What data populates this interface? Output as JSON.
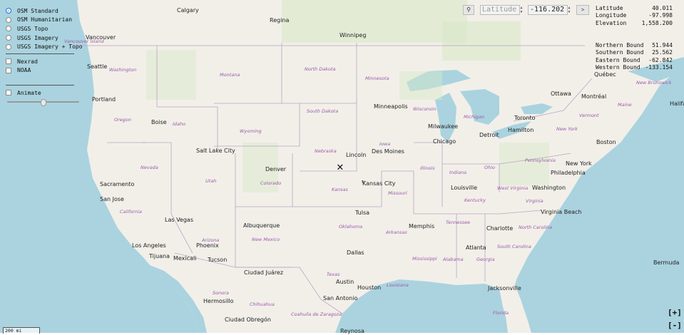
{
  "layers": {
    "base_options": [
      {
        "label": "OSM Standard",
        "selected": true
      },
      {
        "label": "OSM Humanitarian",
        "selected": false
      },
      {
        "label": "USGS Topo",
        "selected": false
      },
      {
        "label": "USGS Imagery",
        "selected": false
      },
      {
        "label": "USGS Imagery + Topo",
        "selected": false
      }
    ],
    "overlays": [
      {
        "label": "Nexrad",
        "checked": false
      },
      {
        "label": "NOAA",
        "checked": false
      }
    ],
    "animate_label": "Animate",
    "animate_checked": false,
    "animate_slider_fraction": 0.5
  },
  "toolbar": {
    "latitude_placeholder": "Latitude",
    "longitude_value": "-116.202",
    "go_label": ">"
  },
  "info": {
    "latitude_label": "Latitude",
    "latitude_value": "40.011",
    "longitude_label": "Longitude",
    "longitude_value": "-97.998",
    "elevation_label": "Elevation",
    "elevation_value": "1,558.200",
    "north_label": "Northern Bound",
    "north_value": "51.944",
    "south_label": "Southern Bound",
    "south_value": "25.562",
    "east_label": "Eastern Bound",
    "east_value": "-62.842",
    "west_label": "Western Bound",
    "west_value": "-133.154"
  },
  "zoom": {
    "in_label": "[+]",
    "out_label": "[-]"
  },
  "scale_label": "200 mi",
  "colors": {
    "land": "#f2efe9",
    "water": "#aad3df",
    "park": "#d8e8c8",
    "border": "#b7a6c2",
    "state_label": "#9a5aa8"
  },
  "map_labels": {
    "cities": [
      "Calgary",
      "Regina",
      "Winnipeg",
      "Vancouver",
      "Seattle",
      "Portland",
      "Boise",
      "Salt Lake City",
      "Sacramento",
      "San Jose",
      "Las Vegas",
      "Los Angeles",
      "Tijuana",
      "Mexicali",
      "Phoenix",
      "Tucson",
      "Albuquerque",
      "Denver",
      "Ciudad Juárez",
      "Hermosillo",
      "Ciudad Obregón",
      "Lincoln",
      "Kansas City",
      "Tulsa",
      "Dallas",
      "Austin",
      "San Antonio",
      "Houston",
      "Minneapolis",
      "Des Moines",
      "Milwaukee",
      "Chicago",
      "Detroit",
      "Toronto",
      "Hamilton",
      "Ottawa",
      "Montréal",
      "Québec",
      "Boston",
      "New York",
      "Philadelphia",
      "Washington",
      "Virginia Beach",
      "Louisville",
      "Memphis",
      "Charlotte",
      "Atlanta",
      "Jacksonville",
      "Halifax",
      "Bermuda",
      "Reynosa"
    ],
    "states": [
      "Washington",
      "Montana",
      "North Dakota",
      "Minnesota",
      "Oregon",
      "Idaho",
      "Wyoming",
      "South Dakota",
      "Wisconsin",
      "Michigan",
      "Nevada",
      "Nebraska",
      "Iowa",
      "Utah",
      "Colorado",
      "Kansas",
      "Missouri",
      "Illinois",
      "Indiana",
      "Ohio",
      "Pennsylvania",
      "West Virginia",
      "Virginia",
      "Kentucky",
      "Tennessee",
      "North Carolina",
      "South Carolina",
      "California",
      "Arizona",
      "New Mexico",
      "Oklahoma",
      "Arkansas",
      "Mississippi",
      "Alabama",
      "Georgia",
      "Texas",
      "Louisiana",
      "Florida",
      "Sonora",
      "Chihuahua",
      "Coahuila de Zaragoza",
      "New York",
      "Vermont",
      "Maine",
      "New Brunswick",
      "Vancouver Island"
    ]
  }
}
